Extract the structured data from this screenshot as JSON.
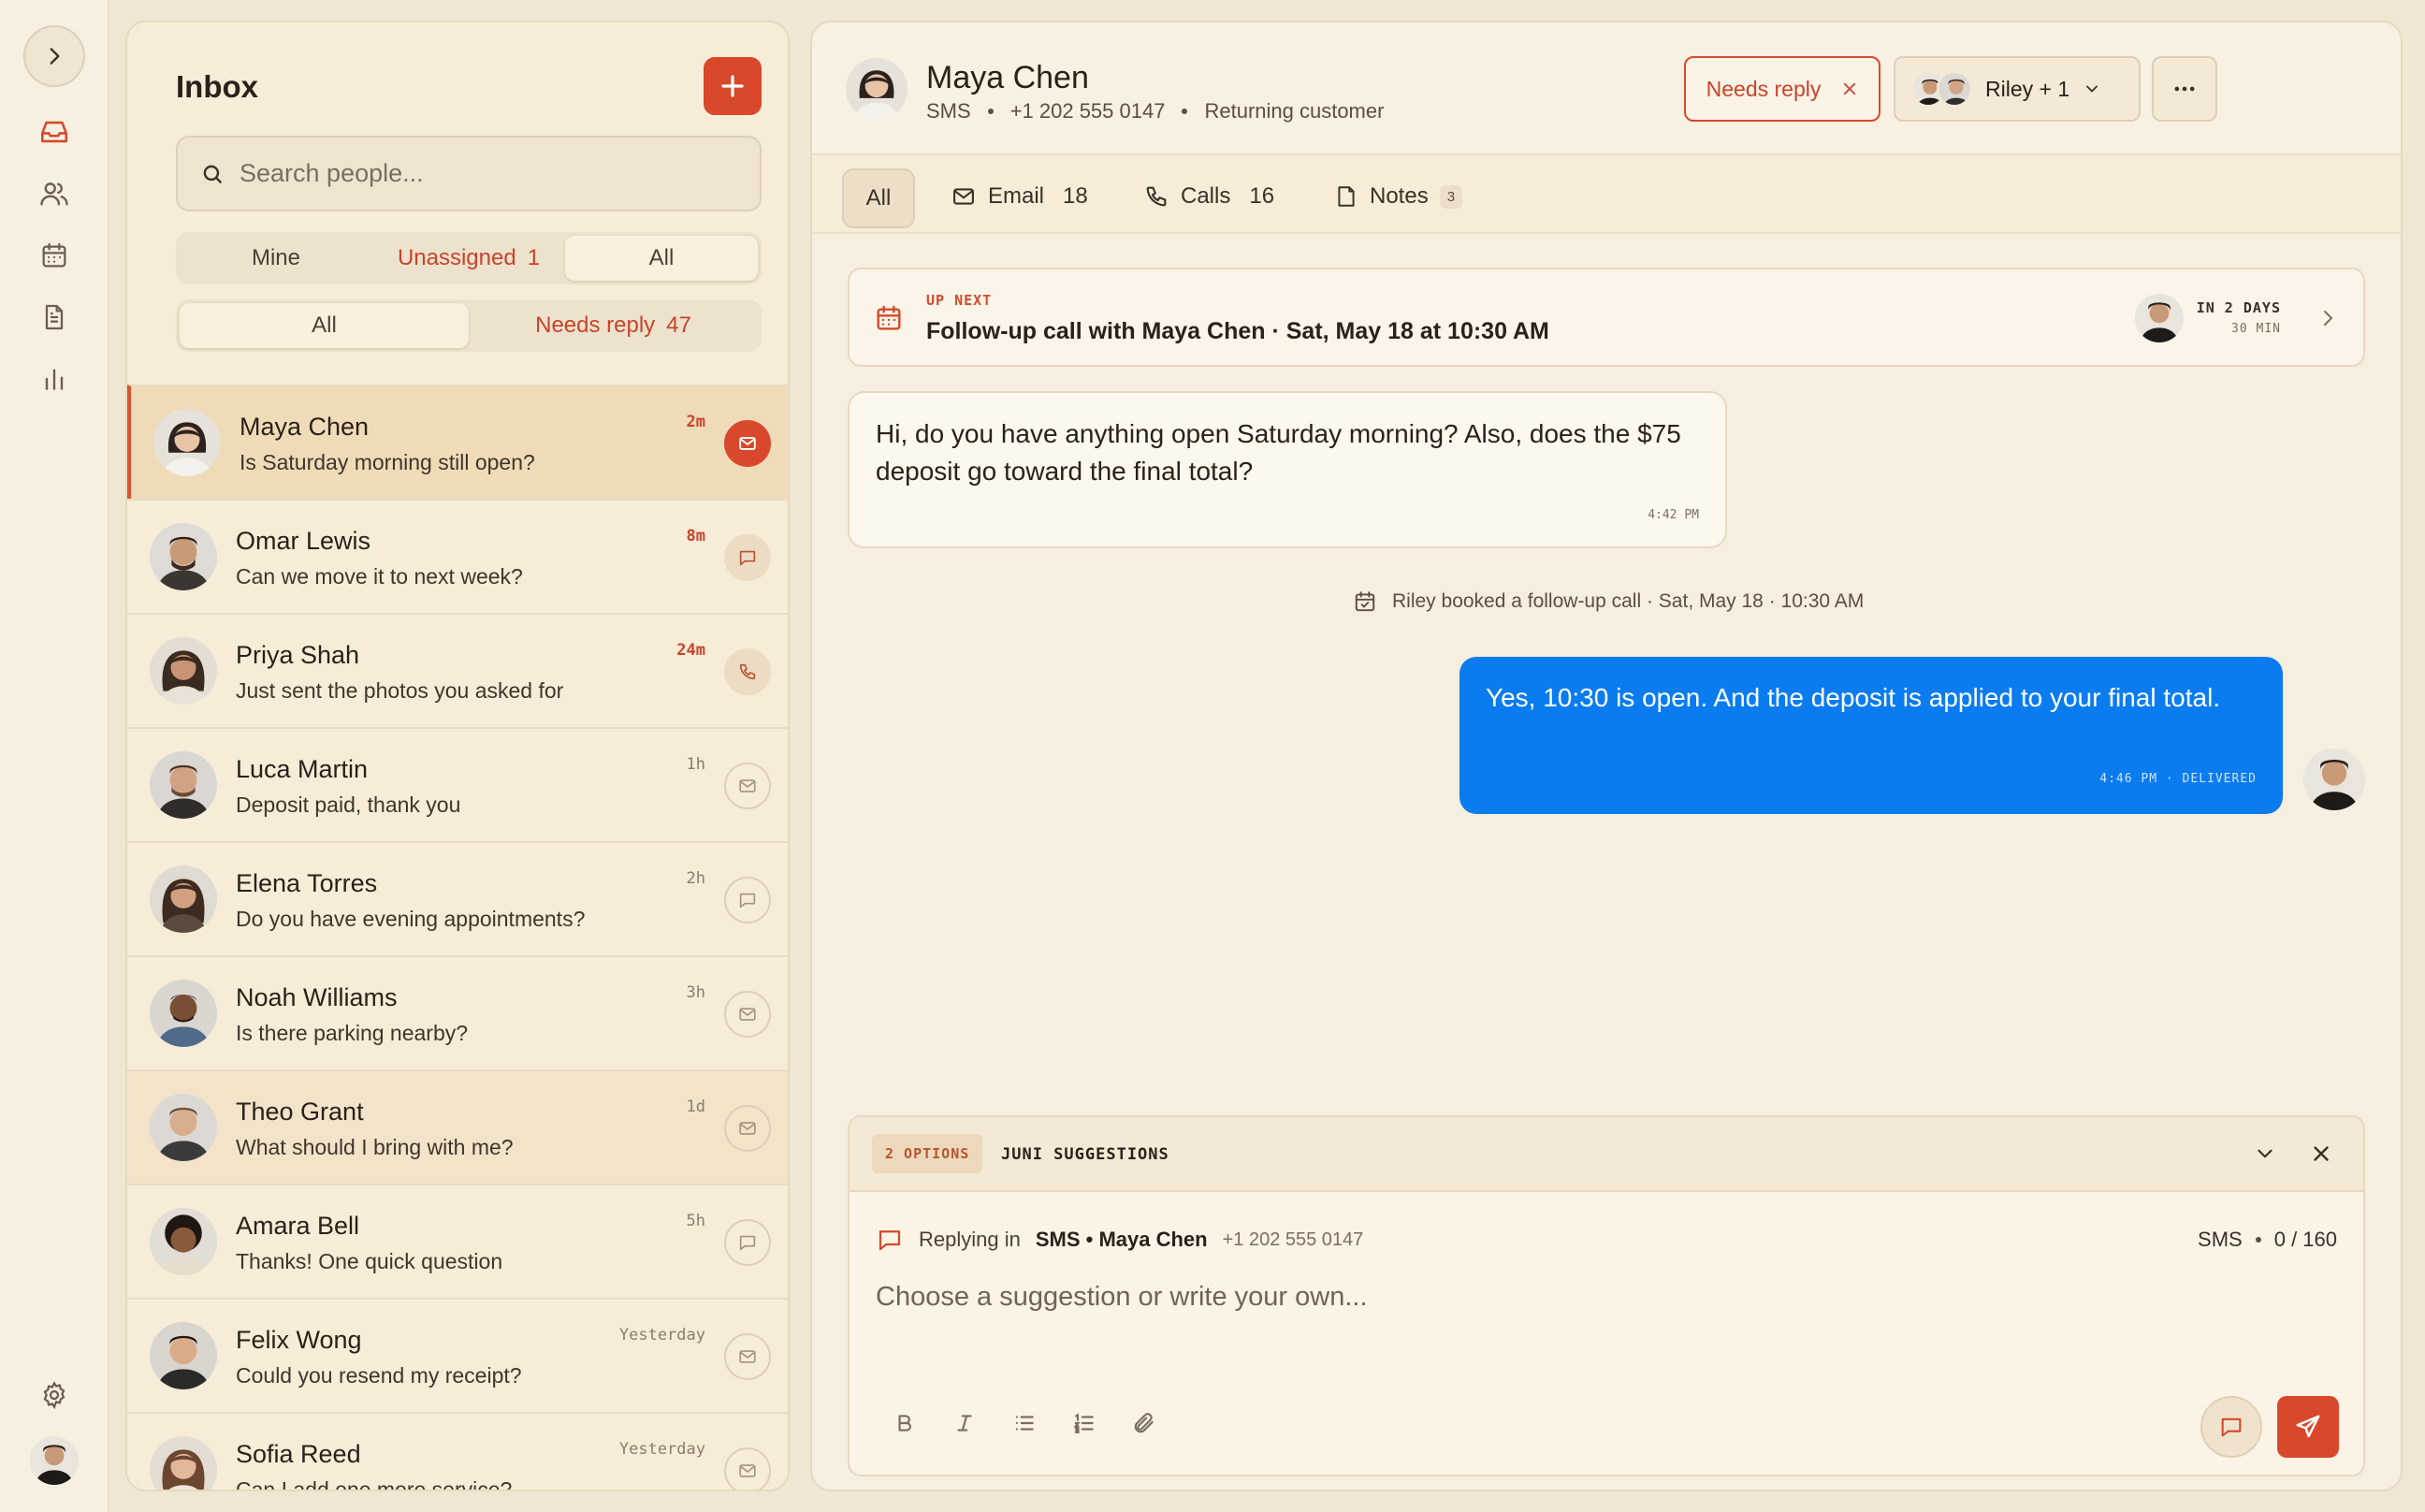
{
  "colors": {
    "accent": "#d9482a",
    "outgoing": "#0a7cf0",
    "background": "#f6eedf"
  },
  "rail": {
    "icons": [
      "chevron-right-icon",
      "inbox-icon",
      "users-icon",
      "calendar-icon",
      "document-icon",
      "bar-chart-icon",
      "gear-icon"
    ]
  },
  "inbox": {
    "title": "Inbox",
    "search_placeholder": "Search people...",
    "scope_tabs": [
      {
        "label": "Mine"
      },
      {
        "label": "Unassigned",
        "count": "1"
      },
      {
        "label": "All"
      }
    ],
    "filter_tabs": [
      {
        "label": "All"
      },
      {
        "label": "Needs reply",
        "count": "47"
      }
    ],
    "conversations": [
      {
        "name": "Maya Chen",
        "preview": "Is Saturday morning still open?",
        "time": "2m",
        "channel": "email"
      },
      {
        "name": "Omar Lewis",
        "preview": "Can we move it to next week?",
        "time": "8m",
        "channel": "sms"
      },
      {
        "name": "Priya Shah",
        "preview": "Just sent the photos you asked for",
        "time": "24m",
        "channel": "call"
      },
      {
        "name": "Luca Martin",
        "preview": "Deposit paid, thank you",
        "time": "1h",
        "channel": "email"
      },
      {
        "name": "Elena Torres",
        "preview": "Do you have evening appointments?",
        "time": "2h",
        "channel": "sms"
      },
      {
        "name": "Noah Williams",
        "preview": "Is there parking nearby?",
        "time": "3h",
        "channel": "email"
      },
      {
        "name": "Theo Grant",
        "preview": "What should I bring with me?",
        "time": "1d",
        "channel": "email"
      },
      {
        "name": "Amara Bell",
        "preview": "Thanks! One quick question",
        "time": "5h",
        "channel": "sms"
      },
      {
        "name": "Felix Wong",
        "preview": "Could you resend my receipt?",
        "time": "Yesterday",
        "channel": "email"
      },
      {
        "name": "Sofia Reed",
        "preview": "Can I add one more service?",
        "time": "Yesterday",
        "channel": "email"
      }
    ]
  },
  "contact": {
    "name": "Maya Chen",
    "channel": "SMS",
    "phone": "+1 202 555 0147",
    "status": "Returning customer",
    "needs_reply_label": "Needs reply",
    "assignee_label": "Riley + 1"
  },
  "tabs": {
    "all": "All",
    "email": {
      "label": "Email",
      "count": "18"
    },
    "calls": {
      "label": "Calls",
      "count": "16"
    },
    "notes": {
      "label": "Notes",
      "count": "3"
    }
  },
  "up_next": {
    "label": "UP NEXT",
    "title": "Follow-up call with Maya Chen · Sat, May 18 at 10:30 AM",
    "when": "IN 2 DAYS",
    "duration": "30 MIN"
  },
  "messages": {
    "incoming": {
      "text": "Hi, do you have anything open Saturday morning? Also, does the $75 deposit go toward the final total?",
      "time": "4:42 PM"
    },
    "event": "Riley booked a follow-up call · Sat, May 18 · 10:30 AM",
    "outgoing": {
      "text": "Yes, 10:30 is open. And the deposit is applied to your final total.",
      "time": "4:46 PM · DELIVERED"
    }
  },
  "suggestions": {
    "count_label": "2 OPTIONS",
    "label": "JUNI SUGGESTIONS"
  },
  "composer": {
    "replying_in": "Replying in",
    "target": "SMS • Maya Chen",
    "phone": "+1 202 555 0147",
    "channel": "SMS",
    "counter": "0 / 160",
    "placeholder": "Choose a suggestion or write your own..."
  }
}
